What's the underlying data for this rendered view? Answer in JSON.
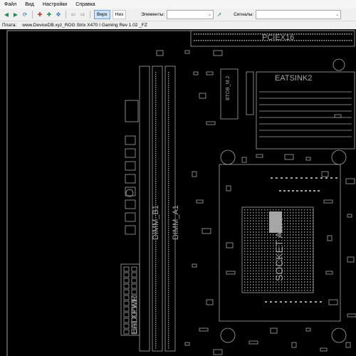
{
  "menu": [
    "Файл",
    "Вид",
    "Настройки",
    "Справка"
  ],
  "toolbar": {
    "side_top": "Верх",
    "side_bottom": "Низ",
    "elements_label": "Элементы:",
    "elements_value": "",
    "signals_label": "Сигналы:",
    "signals_value": ""
  },
  "path": {
    "label": "Плата:",
    "value": "www.DeviceDB.xyz_ROG Strix X470 I Gaming Rev 1.02 _FZ"
  },
  "board": {
    "labels": {
      "pcie": "PCIEX16",
      "heatsink": "EATSINK2",
      "socket": "SOCKET AM4",
      "dimm_b": "DIMM_B1",
      "dimm_a": "DIMM_A1",
      "eatxpwr": "EATXPWR",
      "m2": "BTOB_M.2"
    },
    "trace_color": "#a6a6a6",
    "background_color": "#000000"
  }
}
